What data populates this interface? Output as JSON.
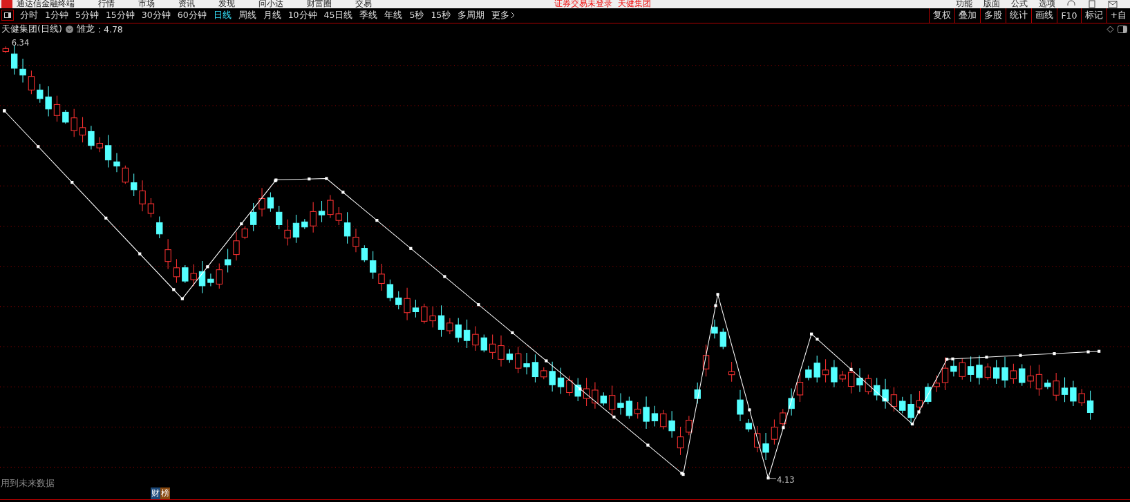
{
  "app": {
    "title": "通达信金融终端",
    "menu": [
      "行情",
      "市场",
      "资讯",
      "发现",
      "问小达",
      "财富圈",
      "交易"
    ],
    "notice": "证券交易未登录",
    "stock": "天健集团",
    "tools": [
      "功能",
      "版面",
      "公式",
      "选项"
    ]
  },
  "periods": [
    {
      "label": "分时",
      "selected": false
    },
    {
      "label": "1分钟",
      "selected": false
    },
    {
      "label": "5分钟",
      "selected": false
    },
    {
      "label": "15分钟",
      "selected": false
    },
    {
      "label": "30分钟",
      "selected": false
    },
    {
      "label": "60分钟",
      "selected": false
    },
    {
      "label": "日线",
      "selected": true
    },
    {
      "label": "周线",
      "selected": false
    },
    {
      "label": "月线",
      "selected": false
    },
    {
      "label": "10分钟",
      "selected": false
    },
    {
      "label": "45日线",
      "selected": false
    },
    {
      "label": "季线",
      "selected": false
    },
    {
      "label": "年线",
      "selected": false
    },
    {
      "label": "5秒",
      "selected": false
    },
    {
      "label": "15秒",
      "selected": false
    },
    {
      "label": "多周期",
      "selected": false
    },
    {
      "label": "更多",
      "selected": false
    }
  ],
  "chart_tools": [
    "复权",
    "叠加",
    "多股",
    "统计",
    "画线",
    "F10",
    "标记",
    "+自"
  ],
  "info": {
    "name": "天健集团(日线)",
    "indicator": "雏龙",
    "value": ": 4.78"
  },
  "chart": {
    "high_label": "6.34",
    "low_label": "4.13",
    "footnote": "用到未来数据",
    "badge": [
      "财",
      "榜"
    ]
  }
}
